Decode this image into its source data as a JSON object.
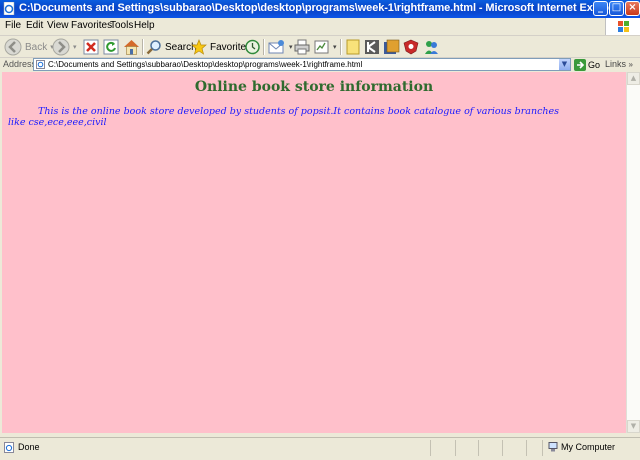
{
  "window": {
    "title": "C:\\Documents and Settings\\subbarao\\Desktop\\desktop\\programs\\week-1\\rightframe.html - Microsoft Internet Explorer",
    "minimize": "_",
    "maximize": "□",
    "close": "×"
  },
  "menu": [
    "File",
    "Edit",
    "View",
    "Favorites",
    "Tools",
    "Help"
  ],
  "toolbar": {
    "back_label": "Back",
    "search_label": "Search",
    "favorites_label": "Favorites"
  },
  "address": {
    "label": "Address",
    "value": "C:\\Documents and Settings\\subbarao\\Desktop\\desktop\\programs\\week-1\\rightframe.html",
    "go_label": "Go",
    "links_label": "Links"
  },
  "page": {
    "heading": "Online book store information",
    "paragraph": "This is the online book store developed by students of popsit.It contains book catalogue of various branches like cse,ece,eee,civil",
    "background": "#ffc0cb",
    "heading_color": "#2f6b2f",
    "text_color": "#1a1aff"
  },
  "status": {
    "text": "Done",
    "zone": "My Computer"
  },
  "icons": [
    "ie-page-icon",
    "back-icon",
    "forward-icon",
    "stop-icon",
    "refresh-icon",
    "home-icon",
    "search-icon",
    "favorites-star-icon",
    "history-icon",
    "mail-icon",
    "print-icon",
    "edit-icon",
    "messenger-icon",
    "go-arrow-icon",
    "my-computer-icon"
  ]
}
